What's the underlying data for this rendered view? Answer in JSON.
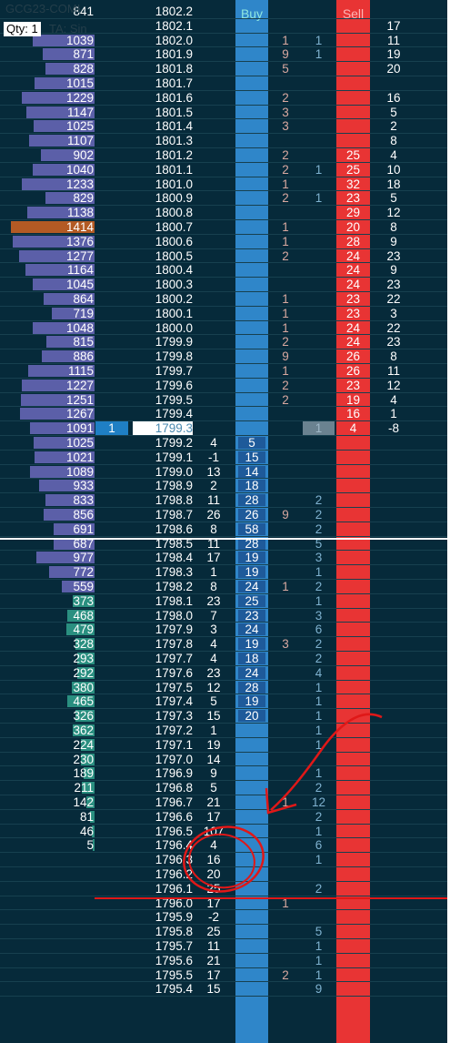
{
  "header": {
    "symbol": "GCG23-COMI",
    "qty_label": "Qty: 1",
    "ta_label": "TA: Sin",
    "buy_label": "Buy",
    "sell_label": "Sell"
  },
  "colors": {
    "background": "#062a3a",
    "buy_column": "#2f86c9",
    "sell_column": "#e83434",
    "volume_bar_upper": "#5b5fa8",
    "volume_bar_lower": "#2a8f80",
    "volume_bar_highlight": "#b35a24",
    "bid_text": "#d8a8a0",
    "ask_text": "#7fb2d0",
    "annotation": "#e01818"
  },
  "rows": [
    {
      "vol": "841",
      "price": "1802.2",
      "delta": "",
      "buy": "",
      "bid": "",
      "ask": "",
      "sell": "",
      "right": "",
      "bar": "",
      "hl": false,
      "cur": false
    },
    {
      "vol": "",
      "price": "1802.1",
      "delta": "",
      "buy": "",
      "bid": "",
      "ask": "",
      "sell": "",
      "right": "17",
      "bar": "",
      "hl": false,
      "cur": false
    },
    {
      "vol": "1039",
      "price": "1802.0",
      "delta": "",
      "buy": "",
      "bid": "1",
      "ask": "1",
      "sell": "",
      "right": "11",
      "bar": "u",
      "hl": false,
      "cur": false
    },
    {
      "vol": "871",
      "price": "1801.9",
      "delta": "",
      "buy": "",
      "bid": "9",
      "ask": "1",
      "sell": "",
      "right": "19",
      "bar": "u",
      "hl": false,
      "cur": false
    },
    {
      "vol": "828",
      "price": "1801.8",
      "delta": "",
      "buy": "",
      "bid": "5",
      "ask": "",
      "sell": "",
      "right": "20",
      "bar": "u",
      "hl": false,
      "cur": false
    },
    {
      "vol": "1015",
      "price": "1801.7",
      "delta": "",
      "buy": "",
      "bid": "",
      "ask": "",
      "sell": "",
      "right": "",
      "bar": "u",
      "hl": false,
      "cur": false
    },
    {
      "vol": "1229",
      "price": "1801.6",
      "delta": "",
      "buy": "",
      "bid": "2",
      "ask": "",
      "sell": "",
      "right": "16",
      "bar": "u",
      "hl": false,
      "cur": false
    },
    {
      "vol": "1147",
      "price": "1801.5",
      "delta": "",
      "buy": "",
      "bid": "3",
      "ask": "",
      "sell": "",
      "right": "5",
      "bar": "u",
      "hl": false,
      "cur": false
    },
    {
      "vol": "1025",
      "price": "1801.4",
      "delta": "",
      "buy": "",
      "bid": "3",
      "ask": "",
      "sell": "",
      "right": "2",
      "bar": "u",
      "hl": false,
      "cur": false
    },
    {
      "vol": "1107",
      "price": "1801.3",
      "delta": "",
      "buy": "",
      "bid": "",
      "ask": "",
      "sell": "",
      "right": "8",
      "bar": "u",
      "hl": false,
      "cur": false
    },
    {
      "vol": "902",
      "price": "1801.2",
      "delta": "",
      "buy": "",
      "bid": "2",
      "ask": "",
      "sell": "25",
      "right": "4",
      "bar": "u",
      "hl": false,
      "cur": false
    },
    {
      "vol": "1040",
      "price": "1801.1",
      "delta": "",
      "buy": "",
      "bid": "2",
      "ask": "1",
      "sell": "25",
      "right": "10",
      "bar": "u",
      "hl": false,
      "cur": false
    },
    {
      "vol": "1233",
      "price": "1801.0",
      "delta": "",
      "buy": "",
      "bid": "1",
      "ask": "",
      "sell": "32",
      "right": "18",
      "bar": "u",
      "hl": false,
      "cur": false
    },
    {
      "vol": "829",
      "price": "1800.9",
      "delta": "",
      "buy": "",
      "bid": "2",
      "ask": "1",
      "sell": "23",
      "right": "5",
      "bar": "u",
      "hl": false,
      "cur": false
    },
    {
      "vol": "1138",
      "price": "1800.8",
      "delta": "",
      "buy": "",
      "bid": "",
      "ask": "",
      "sell": "29",
      "right": "12",
      "bar": "u",
      "hl": false,
      "cur": false
    },
    {
      "vol": "1414",
      "price": "1800.7",
      "delta": "",
      "buy": "",
      "bid": "1",
      "ask": "",
      "sell": "20",
      "right": "8",
      "bar": "h",
      "hl": false,
      "cur": false
    },
    {
      "vol": "1376",
      "price": "1800.6",
      "delta": "",
      "buy": "",
      "bid": "1",
      "ask": "",
      "sell": "28",
      "right": "9",
      "bar": "u",
      "hl": false,
      "cur": false
    },
    {
      "vol": "1277",
      "price": "1800.5",
      "delta": "",
      "buy": "",
      "bid": "2",
      "ask": "",
      "sell": "24",
      "right": "23",
      "bar": "u",
      "hl": false,
      "cur": false
    },
    {
      "vol": "1164",
      "price": "1800.4",
      "delta": "",
      "buy": "",
      "bid": "",
      "ask": "",
      "sell": "24",
      "right": "9",
      "bar": "u",
      "hl": false,
      "cur": false
    },
    {
      "vol": "1045",
      "price": "1800.3",
      "delta": "",
      "buy": "",
      "bid": "",
      "ask": "",
      "sell": "24",
      "right": "23",
      "bar": "u",
      "hl": false,
      "cur": false
    },
    {
      "vol": "864",
      "price": "1800.2",
      "delta": "",
      "buy": "",
      "bid": "1",
      "ask": "",
      "sell": "23",
      "right": "22",
      "bar": "u",
      "hl": false,
      "cur": false
    },
    {
      "vol": "719",
      "price": "1800.1",
      "delta": "",
      "buy": "",
      "bid": "1",
      "ask": "",
      "sell": "23",
      "right": "3",
      "bar": "u",
      "hl": false,
      "cur": false
    },
    {
      "vol": "1048",
      "price": "1800.0",
      "delta": "",
      "buy": "",
      "bid": "1",
      "ask": "",
      "sell": "24",
      "right": "22",
      "bar": "u",
      "hl": false,
      "cur": false
    },
    {
      "vol": "815",
      "price": "1799.9",
      "delta": "",
      "buy": "",
      "bid": "2",
      "ask": "",
      "sell": "24",
      "right": "23",
      "bar": "u",
      "hl": false,
      "cur": false
    },
    {
      "vol": "886",
      "price": "1799.8",
      "delta": "",
      "buy": "",
      "bid": "9",
      "ask": "",
      "sell": "26",
      "right": "8",
      "bar": "u",
      "hl": false,
      "cur": false
    },
    {
      "vol": "1115",
      "price": "1799.7",
      "delta": "",
      "buy": "",
      "bid": "1",
      "ask": "",
      "sell": "26",
      "right": "11",
      "bar": "u",
      "hl": false,
      "cur": false
    },
    {
      "vol": "1227",
      "price": "1799.6",
      "delta": "",
      "buy": "",
      "bid": "2",
      "ask": "",
      "sell": "23",
      "right": "12",
      "bar": "u",
      "hl": false,
      "cur": false
    },
    {
      "vol": "1251",
      "price": "1799.5",
      "delta": "",
      "buy": "",
      "bid": "2",
      "ask": "",
      "sell": "19",
      "right": "4",
      "bar": "u",
      "hl": false,
      "cur": false
    },
    {
      "vol": "1267",
      "price": "1799.4",
      "delta": "",
      "buy": "",
      "bid": "",
      "ask": "",
      "sell": "16",
      "right": "1",
      "bar": "u",
      "hl": false,
      "cur": false
    },
    {
      "vol": "1091",
      "price": "1799.3",
      "delta": "",
      "buy": "",
      "bid": "",
      "ask": "1",
      "sell": "4",
      "right": "-8",
      "bar": "u",
      "hl": false,
      "cur": true,
      "order": "1"
    },
    {
      "vol": "1025",
      "price": "1799.2",
      "delta": "4",
      "buy": "5",
      "bid": "",
      "ask": "",
      "sell": "",
      "right": "",
      "bar": "u",
      "hl": true,
      "cur": false
    },
    {
      "vol": "1021",
      "price": "1799.1",
      "delta": "-1",
      "buy": "15",
      "bid": "",
      "ask": "",
      "sell": "",
      "right": "",
      "bar": "u",
      "hl": true,
      "cur": false
    },
    {
      "vol": "1089",
      "price": "1799.0",
      "delta": "13",
      "buy": "14",
      "bid": "",
      "ask": "",
      "sell": "",
      "right": "",
      "bar": "u",
      "hl": true,
      "cur": false
    },
    {
      "vol": "933",
      "price": "1798.9",
      "delta": "2",
      "buy": "18",
      "bid": "",
      "ask": "",
      "sell": "",
      "right": "",
      "bar": "u",
      "hl": true,
      "cur": false
    },
    {
      "vol": "833",
      "price": "1798.8",
      "delta": "11",
      "buy": "28",
      "bid": "",
      "ask": "2",
      "sell": "",
      "right": "",
      "bar": "u",
      "hl": true,
      "cur": false
    },
    {
      "vol": "856",
      "price": "1798.7",
      "delta": "26",
      "buy": "26",
      "bid": "9",
      "ask": "2",
      "sell": "",
      "right": "",
      "bar": "u",
      "hl": true,
      "cur": false
    },
    {
      "vol": "691",
      "price": "1798.6",
      "delta": "8",
      "buy": "58",
      "bid": "",
      "ask": "2",
      "sell": "",
      "right": "",
      "bar": "u",
      "hl": true,
      "cur": false
    },
    {
      "vol": "687",
      "price": "1798.5",
      "delta": "11",
      "buy": "28",
      "bid": "",
      "ask": "5",
      "sell": "",
      "right": "",
      "bar": "u",
      "hl": true,
      "cur": false
    },
    {
      "vol": "977",
      "price": "1798.4",
      "delta": "17",
      "buy": "19",
      "bid": "",
      "ask": "3",
      "sell": "",
      "right": "",
      "bar": "u",
      "hl": true,
      "cur": false
    },
    {
      "vol": "772",
      "price": "1798.3",
      "delta": "1",
      "buy": "19",
      "bid": "",
      "ask": "1",
      "sell": "",
      "right": "",
      "bar": "u",
      "hl": true,
      "cur": false
    },
    {
      "vol": "559",
      "price": "1798.2",
      "delta": "8",
      "buy": "24",
      "bid": "1",
      "ask": "2",
      "sell": "",
      "right": "",
      "bar": "u",
      "hl": true,
      "cur": false
    },
    {
      "vol": "373",
      "price": "1798.1",
      "delta": "23",
      "buy": "25",
      "bid": "",
      "ask": "1",
      "sell": "",
      "right": "",
      "bar": "l",
      "hl": true,
      "cur": false
    },
    {
      "vol": "468",
      "price": "1798.0",
      "delta": "7",
      "buy": "23",
      "bid": "",
      "ask": "3",
      "sell": "",
      "right": "",
      "bar": "l",
      "hl": true,
      "cur": false
    },
    {
      "vol": "479",
      "price": "1797.9",
      "delta": "3",
      "buy": "24",
      "bid": "",
      "ask": "6",
      "sell": "",
      "right": "",
      "bar": "l",
      "hl": true,
      "cur": false
    },
    {
      "vol": "328",
      "price": "1797.8",
      "delta": "4",
      "buy": "19",
      "bid": "3",
      "ask": "2",
      "sell": "",
      "right": "",
      "bar": "l",
      "hl": true,
      "cur": false
    },
    {
      "vol": "293",
      "price": "1797.7",
      "delta": "4",
      "buy": "18",
      "bid": "",
      "ask": "2",
      "sell": "",
      "right": "",
      "bar": "l",
      "hl": true,
      "cur": false
    },
    {
      "vol": "292",
      "price": "1797.6",
      "delta": "23",
      "buy": "24",
      "bid": "",
      "ask": "4",
      "sell": "",
      "right": "",
      "bar": "l",
      "hl": true,
      "cur": false
    },
    {
      "vol": "380",
      "price": "1797.5",
      "delta": "12",
      "buy": "28",
      "bid": "",
      "ask": "1",
      "sell": "",
      "right": "",
      "bar": "l",
      "hl": true,
      "cur": false
    },
    {
      "vol": "465",
      "price": "1797.4",
      "delta": "5",
      "buy": "19",
      "bid": "",
      "ask": "1",
      "sell": "",
      "right": "",
      "bar": "l",
      "hl": true,
      "cur": false
    },
    {
      "vol": "326",
      "price": "1797.3",
      "delta": "15",
      "buy": "20",
      "bid": "",
      "ask": "1",
      "sell": "",
      "right": "",
      "bar": "l",
      "hl": true,
      "cur": false
    },
    {
      "vol": "362",
      "price": "1797.2",
      "delta": "1",
      "buy": "",
      "bid": "",
      "ask": "1",
      "sell": "",
      "right": "",
      "bar": "l",
      "hl": false,
      "cur": false
    },
    {
      "vol": "224",
      "price": "1797.1",
      "delta": "19",
      "buy": "",
      "bid": "",
      "ask": "1",
      "sell": "",
      "right": "",
      "bar": "l",
      "hl": false,
      "cur": false
    },
    {
      "vol": "230",
      "price": "1797.0",
      "delta": "14",
      "buy": "",
      "bid": "",
      "ask": "",
      "sell": "",
      "right": "",
      "bar": "l",
      "hl": false,
      "cur": false
    },
    {
      "vol": "189",
      "price": "1796.9",
      "delta": "9",
      "buy": "",
      "bid": "",
      "ask": "1",
      "sell": "",
      "right": "",
      "bar": "l",
      "hl": false,
      "cur": false
    },
    {
      "vol": "211",
      "price": "1796.8",
      "delta": "5",
      "buy": "",
      "bid": "",
      "ask": "2",
      "sell": "",
      "right": "",
      "bar": "l",
      "hl": false,
      "cur": false
    },
    {
      "vol": "142",
      "price": "1796.7",
      "delta": "21",
      "buy": "",
      "bid": "1",
      "ask": "12",
      "sell": "",
      "right": "",
      "bar": "l",
      "hl": false,
      "cur": false
    },
    {
      "vol": "81",
      "price": "1796.6",
      "delta": "17",
      "buy": "",
      "bid": "",
      "ask": "2",
      "sell": "",
      "right": "",
      "bar": "l",
      "hl": false,
      "cur": false
    },
    {
      "vol": "46",
      "price": "1796.5",
      "delta": "107",
      "buy": "",
      "bid": "",
      "ask": "1",
      "sell": "",
      "right": "",
      "bar": "l",
      "hl": false,
      "cur": false
    },
    {
      "vol": "5",
      "price": "1796.4",
      "delta": "4",
      "buy": "",
      "bid": "",
      "ask": "6",
      "sell": "",
      "right": "",
      "bar": "l",
      "hl": false,
      "cur": false
    },
    {
      "vol": "",
      "price": "1796.3",
      "delta": "16",
      "buy": "",
      "bid": "",
      "ask": "1",
      "sell": "",
      "right": "",
      "bar": "",
      "hl": false,
      "cur": false
    },
    {
      "vol": "",
      "price": "1796.2",
      "delta": "20",
      "buy": "",
      "bid": "",
      "ask": "",
      "sell": "",
      "right": "",
      "bar": "",
      "hl": false,
      "cur": false
    },
    {
      "vol": "",
      "price": "1796.1",
      "delta": "25",
      "buy": "",
      "bid": "",
      "ask": "2",
      "sell": "",
      "right": "",
      "bar": "",
      "hl": false,
      "cur": false
    },
    {
      "vol": "",
      "price": "1796.0",
      "delta": "17",
      "buy": "",
      "bid": "1",
      "ask": "",
      "sell": "",
      "right": "",
      "bar": "",
      "hl": false,
      "cur": false
    },
    {
      "vol": "",
      "price": "1795.9",
      "delta": "-2",
      "buy": "",
      "bid": "",
      "ask": "",
      "sell": "",
      "right": "",
      "bar": "",
      "hl": false,
      "cur": false
    },
    {
      "vol": "",
      "price": "1795.8",
      "delta": "25",
      "buy": "",
      "bid": "",
      "ask": "5",
      "sell": "",
      "right": "",
      "bar": "",
      "hl": false,
      "cur": false
    },
    {
      "vol": "",
      "price": "1795.7",
      "delta": "11",
      "buy": "",
      "bid": "",
      "ask": "1",
      "sell": "",
      "right": "",
      "bar": "",
      "hl": false,
      "cur": false
    },
    {
      "vol": "",
      "price": "1795.6",
      "delta": "21",
      "buy": "",
      "bid": "",
      "ask": "1",
      "sell": "",
      "right": "",
      "bar": "",
      "hl": false,
      "cur": false
    },
    {
      "vol": "",
      "price": "1795.5",
      "delta": "17",
      "buy": "",
      "bid": "2",
      "ask": "1",
      "sell": "",
      "right": "",
      "bar": "",
      "hl": false,
      "cur": false
    },
    {
      "vol": "",
      "price": "1795.4",
      "delta": "15",
      "buy": "",
      "bid": "",
      "ask": "9",
      "sell": "",
      "right": "",
      "bar": "",
      "hl": false,
      "cur": false
    }
  ]
}
